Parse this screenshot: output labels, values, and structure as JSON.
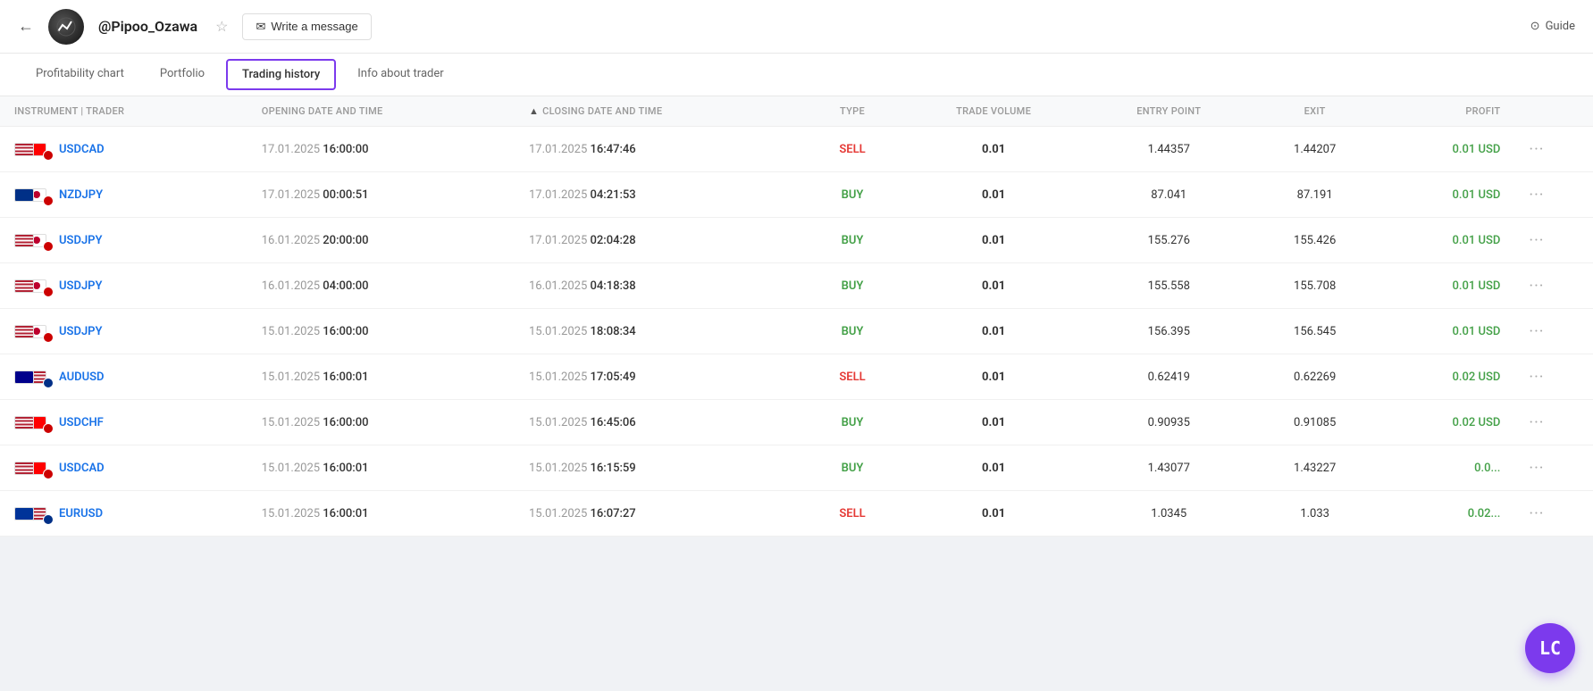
{
  "header": {
    "back_label": "←",
    "username": "@Pipoo_Ozawa",
    "star_icon": "☆",
    "write_message_label": "Write a message",
    "guide_label": "Guide"
  },
  "nav": {
    "tabs": [
      {
        "id": "profitability",
        "label": "Profitability chart",
        "active": false
      },
      {
        "id": "portfolio",
        "label": "Portfolio",
        "active": false
      },
      {
        "id": "trading-history",
        "label": "Trading history",
        "active": true
      },
      {
        "id": "info",
        "label": "Info about trader",
        "active": false
      }
    ]
  },
  "table": {
    "columns": [
      {
        "id": "instrument",
        "label": "INSTRUMENT | TRADER"
      },
      {
        "id": "opening",
        "label": "OPENING DATE AND TIME"
      },
      {
        "id": "closing",
        "label": "CLOSING DATE AND TIME",
        "sorted": true
      },
      {
        "id": "type",
        "label": "TYPE"
      },
      {
        "id": "volume",
        "label": "TRADE VOLUME"
      },
      {
        "id": "entry",
        "label": "ENTRY POINT"
      },
      {
        "id": "exit",
        "label": "EXIT"
      },
      {
        "id": "profit",
        "label": "PROFIT"
      }
    ],
    "rows": [
      {
        "instrument": "USDCAD",
        "flag1": "us",
        "flag2": "ca",
        "dot": "red",
        "opening_date": "17.01.2025",
        "opening_time": "16:00:00",
        "closing_date": "17.01.2025",
        "closing_time": "16:47:46",
        "type": "SELL",
        "type_class": "sell",
        "volume": "0.01",
        "entry": "1.44357",
        "exit": "1.44207",
        "profit": "0.01 USD"
      },
      {
        "instrument": "NZDJPY",
        "flag1": "nz",
        "flag2": "jp",
        "dot": "red",
        "opening_date": "17.01.2025",
        "opening_time": "00:00:51",
        "closing_date": "17.01.2025",
        "closing_time": "04:21:53",
        "type": "BUY",
        "type_class": "buy",
        "volume": "0.01",
        "entry": "87.041",
        "exit": "87.191",
        "profit": "0.01 USD"
      },
      {
        "instrument": "USDJPY",
        "flag1": "us",
        "flag2": "jp",
        "dot": "red",
        "opening_date": "16.01.2025",
        "opening_time": "20:00:00",
        "closing_date": "17.01.2025",
        "closing_time": "02:04:28",
        "type": "BUY",
        "type_class": "buy",
        "volume": "0.01",
        "entry": "155.276",
        "exit": "155.426",
        "profit": "0.01 USD"
      },
      {
        "instrument": "USDJPY",
        "flag1": "us",
        "flag2": "jp",
        "dot": "red",
        "opening_date": "16.01.2025",
        "opening_time": "04:00:00",
        "closing_date": "16.01.2025",
        "closing_time": "04:18:38",
        "type": "BUY",
        "type_class": "buy",
        "volume": "0.01",
        "entry": "155.558",
        "exit": "155.708",
        "profit": "0.01 USD"
      },
      {
        "instrument": "USDJPY",
        "flag1": "us",
        "flag2": "jp",
        "dot": "red",
        "opening_date": "15.01.2025",
        "opening_time": "16:00:00",
        "closing_date": "15.01.2025",
        "closing_time": "18:08:34",
        "type": "BUY",
        "type_class": "buy",
        "volume": "0.01",
        "entry": "156.395",
        "exit": "156.545",
        "profit": "0.01 USD"
      },
      {
        "instrument": "AUDUSD",
        "flag1": "au",
        "flag2": "us",
        "dot": "blue",
        "opening_date": "15.01.2025",
        "opening_time": "16:00:01",
        "closing_date": "15.01.2025",
        "closing_time": "17:05:49",
        "type": "SELL",
        "type_class": "sell",
        "volume": "0.01",
        "entry": "0.62419",
        "exit": "0.62269",
        "profit": "0.02 USD"
      },
      {
        "instrument": "USDCHF",
        "flag1": "us",
        "flag2": "ch",
        "dot": "red",
        "opening_date": "15.01.2025",
        "opening_time": "16:00:00",
        "closing_date": "15.01.2025",
        "closing_time": "16:45:06",
        "type": "BUY",
        "type_class": "buy",
        "volume": "0.01",
        "entry": "0.90935",
        "exit": "0.91085",
        "profit": "0.02 USD"
      },
      {
        "instrument": "USDCAD",
        "flag1": "us",
        "flag2": "ca",
        "dot": "red",
        "opening_date": "15.01.2025",
        "opening_time": "16:00:01",
        "closing_date": "15.01.2025",
        "closing_time": "16:15:59",
        "type": "BUY",
        "type_class": "buy",
        "volume": "0.01",
        "entry": "1.43077",
        "exit": "1.43227",
        "profit": "0.0..."
      },
      {
        "instrument": "EURUSD",
        "flag1": "eu",
        "flag2": "us",
        "dot": "blue",
        "opening_date": "15.01.2025",
        "opening_time": "16:00:01",
        "closing_date": "15.01.2025",
        "closing_time": "16:07:27",
        "type": "SELL",
        "type_class": "sell",
        "volume": "0.01",
        "entry": "1.0345",
        "exit": "1.033",
        "profit": "0.02..."
      }
    ]
  },
  "logo": {
    "symbol": "LC"
  }
}
